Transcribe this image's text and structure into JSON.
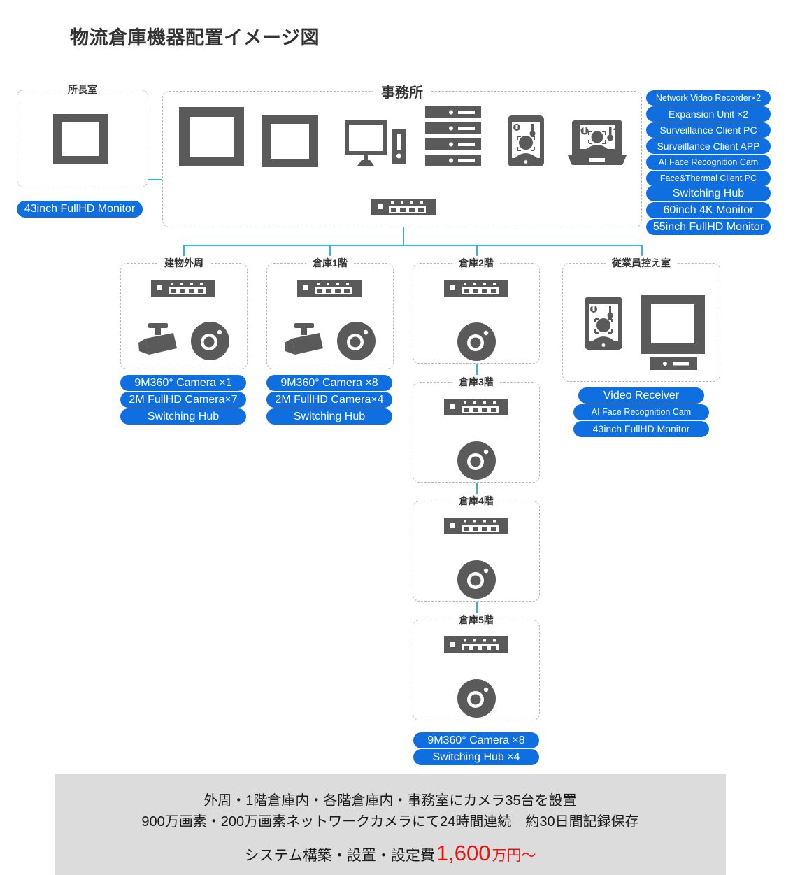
{
  "title": "物流倉庫機器配置イメージ図",
  "rooms": {
    "director": {
      "title": "所長室",
      "devices": [
        "monitor-43"
      ]
    },
    "office": {
      "title": "事務所"
    },
    "perimeter": {
      "title": "建物外周"
    },
    "warehouse1": {
      "title": "倉庫1階"
    },
    "warehouse2": {
      "title": "倉庫2階"
    },
    "warehouse3": {
      "title": "倉庫3階"
    },
    "warehouse4": {
      "title": "倉庫4階"
    },
    "warehouse5": {
      "title": "倉庫5階"
    },
    "breakroom": {
      "title": "従業員控え室"
    }
  },
  "labels": {
    "director": [
      "43inch FullHD Monitor"
    ],
    "office": [
      "Network Video Recorder×2",
      "Expansion Unit ×2",
      "Surveillance Client PC",
      "Surveillance Client APP",
      "AI Face Recognition Cam",
      "Face&Thermal Client PC",
      "Switching Hub",
      "60inch 4K Monitor",
      "55inch FullHD Monitor"
    ],
    "perimeter": [
      "9M360° Camera ×1",
      "2M FullHD Camera×7",
      "Switching Hub"
    ],
    "warehouse1": [
      "9M360° Camera ×8",
      "2M FullHD Camera×4",
      "Switching Hub"
    ],
    "warehouse_floors": [
      "9M360° Camera ×8",
      "Switching Hub ×4"
    ],
    "breakroom": [
      "Video Receiver",
      "AI Face Recognition Cam",
      "43inch FullHD Monitor"
    ]
  },
  "icons": {
    "monitor": "monitor-icon",
    "desktop_pc": "desktop-pc-icon",
    "server_rack": "server-rack-icon",
    "tablet_face": "tablet-face-recognition-icon",
    "laptop_face": "laptop-face-recognition-icon",
    "switching_hub": "switching-hub-icon",
    "bullet_camera": "bullet-camera-icon",
    "dome_camera": "dome-360-camera-icon",
    "video_receiver": "video-receiver-icon"
  },
  "summary": {
    "line1": "外周・1階倉庫内・各階倉庫内・事務室にカメラ35台を設置",
    "line2": "900万画素・200万画素ネットワークカメラにて24時間連続　約30日間記録保存",
    "line3_prefix": "システム構築・設置・設定費",
    "price": "1,600",
    "price_unit": "万円〜"
  },
  "colors": {
    "accent_blue": "#0f6fe0",
    "line_cyan": "#29b6e8",
    "device_grey": "#5a5a5a",
    "price_red": "#e8150f",
    "summary_bg": "#dcdcdc"
  }
}
